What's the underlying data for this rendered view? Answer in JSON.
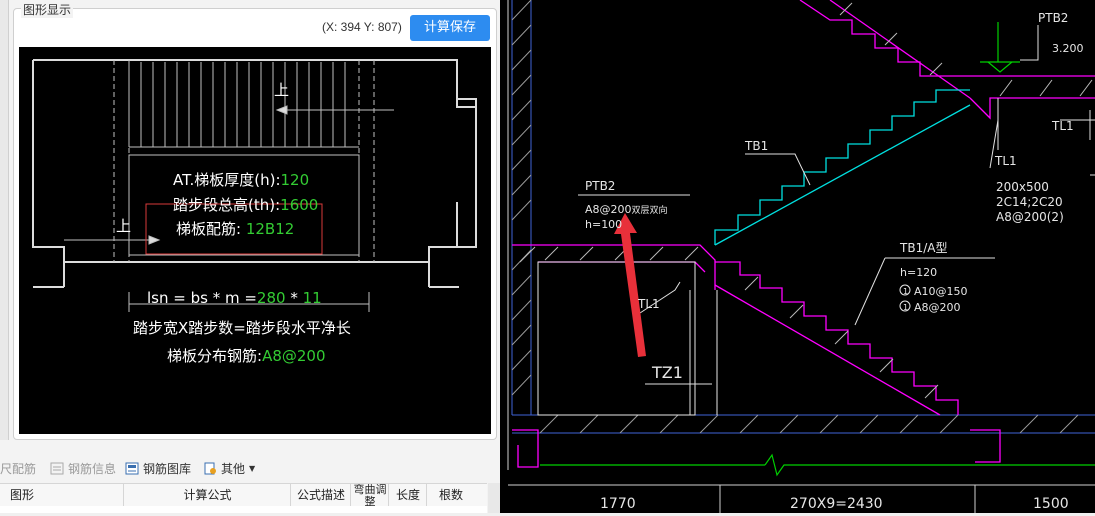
{
  "panel": {
    "title": "图形显示",
    "coords": "(X: 394 Y: 807)",
    "save_button": "计算保存"
  },
  "diagram": {
    "label_up_1": "上",
    "label_up_2": "上",
    "thickness_label": "AT.梯板厚度(h):",
    "thickness_value": "120",
    "height_label": "踏步段总高(th):",
    "height_value": "1600",
    "rebar_label": "梯板配筋: ",
    "rebar_value": "12B12",
    "formula_prefix": "lsn = bs * m =",
    "formula_bs": "280",
    "formula_op": " * ",
    "formula_m": "11",
    "formula_desc": "踏步宽X踏步数=踏步段水平净长",
    "dist_label": "梯板分布钢筋:",
    "dist_value": "A8@200"
  },
  "toolbar": {
    "items": [
      "尺配筋",
      "钢筋信息",
      "钢筋图库",
      "其他"
    ]
  },
  "grid": {
    "columns": [
      "图形",
      "计算公式",
      "公式描述",
      "弯曲调整",
      "长度",
      "根数"
    ]
  },
  "cad": {
    "ptb2_top": "PTB2",
    "elev": "3.200",
    "tl1_right": "TL1",
    "tl1_mid": "TL1",
    "beam_size": "200x500",
    "beam_rebar": "2C14;2C20",
    "beam_stirrup": "A8@200(2)",
    "tb1": "TB1",
    "ptb2_left": "PTB2",
    "ptb2_rebar": "A8@200",
    "ptb2_note": "双层双向",
    "ptb2_h": "h=100",
    "tl1_left": "TL1",
    "tb1a": "TB1/A型",
    "tb1a_h": "h=120",
    "tb1a_r1_num": "1",
    "tb1a_r1": "A10@150",
    "tb1a_r2_num": "1",
    "tb1a_r2": "A8@200",
    "tz1": "TZ1",
    "dim1": "1770",
    "dim2": "270X9=2430",
    "dim3": "1500"
  },
  "colors": {
    "accent": "#2d8cf0",
    "value_green": "#33cc33",
    "cad_magenta": "#ff00ff",
    "cad_cyan": "#00e0e0",
    "cad_red": "#e8303a"
  }
}
